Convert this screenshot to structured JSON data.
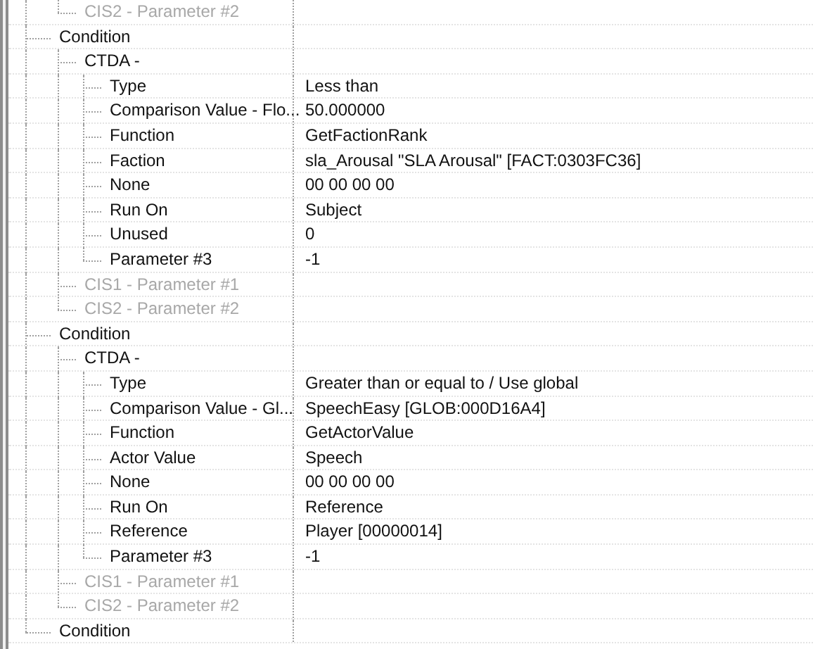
{
  "tree": [
    {
      "children": [
        {
          "label": "CIS2 - Parameter #2",
          "disabled": true
        }
      ]
    },
    {
      "label": "Condition",
      "disabled": false,
      "children": [
        {
          "label": "CTDA -",
          "disabled": false,
          "children": [
            {
              "label": "Type",
              "value": "Less than",
              "disabled": false
            },
            {
              "label": "Comparison Value - Flo...",
              "value": "50.000000",
              "disabled": false
            },
            {
              "label": "Function",
              "value": "GetFactionRank",
              "disabled": false
            },
            {
              "label": "Faction",
              "value": "sla_Arousal \"SLA Arousal\" [FACT:0303FC36]",
              "disabled": false
            },
            {
              "label": "None",
              "value": "00 00 00 00",
              "disabled": false
            },
            {
              "label": "Run On",
              "value": "Subject",
              "disabled": false
            },
            {
              "label": "Unused",
              "value": "0",
              "disabled": false
            },
            {
              "label": "Parameter #3",
              "value": "-1",
              "disabled": false
            }
          ]
        },
        {
          "label": "CIS1 - Parameter #1",
          "disabled": true
        },
        {
          "label": "CIS2 - Parameter #2",
          "disabled": true
        }
      ]
    },
    {
      "label": "Condition",
      "disabled": false,
      "children": [
        {
          "label": "CTDA -",
          "disabled": false,
          "children": [
            {
              "label": "Type",
              "value": "Greater than or equal to / Use global",
              "disabled": false
            },
            {
              "label": "Comparison Value - Gl...",
              "value": "SpeechEasy [GLOB:000D16A4]",
              "disabled": false
            },
            {
              "label": "Function",
              "value": "GetActorValue",
              "disabled": false
            },
            {
              "label": "Actor Value",
              "value": "Speech",
              "disabled": false
            },
            {
              "label": "None",
              "value": "00 00 00 00",
              "disabled": false
            },
            {
              "label": "Run On",
              "value": "Reference",
              "disabled": false
            },
            {
              "label": "Reference",
              "value": "Player [00000014]",
              "disabled": false
            },
            {
              "label": "Parameter #3",
              "value": "-1",
              "disabled": false
            }
          ]
        },
        {
          "label": "CIS1 - Parameter #1",
          "disabled": true
        },
        {
          "label": "CIS2 - Parameter #2",
          "disabled": true
        }
      ]
    },
    {
      "label": "Condition",
      "disabled": false
    }
  ]
}
